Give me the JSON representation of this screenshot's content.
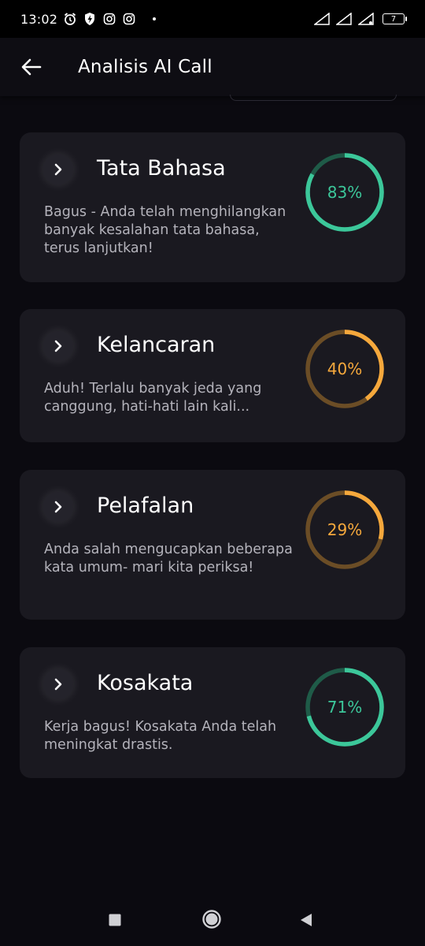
{
  "status_bar": {
    "time": "13:02",
    "battery": "7",
    "icons": [
      "alarm-icon",
      "shield-bolt-icon",
      "instagram-icon",
      "instagram-icon",
      "signal-icon",
      "signal-icon",
      "signal-icon",
      "battery-icon"
    ]
  },
  "app_bar": {
    "title": "Analisis AI Call",
    "back_icon": "arrow-left-icon"
  },
  "cards": [
    {
      "title": "Tata Bahasa",
      "description": "Bagus - Anda telah menghilangkan banyak kesalahan tata bahasa, terus lanjutkan!",
      "percent_label": "83%",
      "percent": 83,
      "color": "#3cc79a",
      "track_color": "#1f5b48"
    },
    {
      "title": "Kelancaran",
      "description": "Aduh! Terlalu banyak jeda yang canggung, hati-hati lain kali...",
      "percent_label": "40%",
      "percent": 40,
      "color": "#f5a83c",
      "track_color": "#6b4d26"
    },
    {
      "title": "Pelafalan",
      "description": "Anda salah mengucapkan beberapa kata umum- mari kita periksa!",
      "percent_label": "29%",
      "percent": 29,
      "color": "#f5a83c",
      "track_color": "#6b4d26"
    },
    {
      "title": "Kosakata",
      "description": "Kerja bagus! Kosakata Anda telah meningkat drastis.",
      "percent_label": "71%",
      "percent": 71,
      "color": "#3cc79a",
      "track_color": "#1f5b48"
    }
  ],
  "nav_bar": {
    "icons": [
      "recents-square-icon",
      "home-circle-icon",
      "back-triangle-icon"
    ]
  }
}
